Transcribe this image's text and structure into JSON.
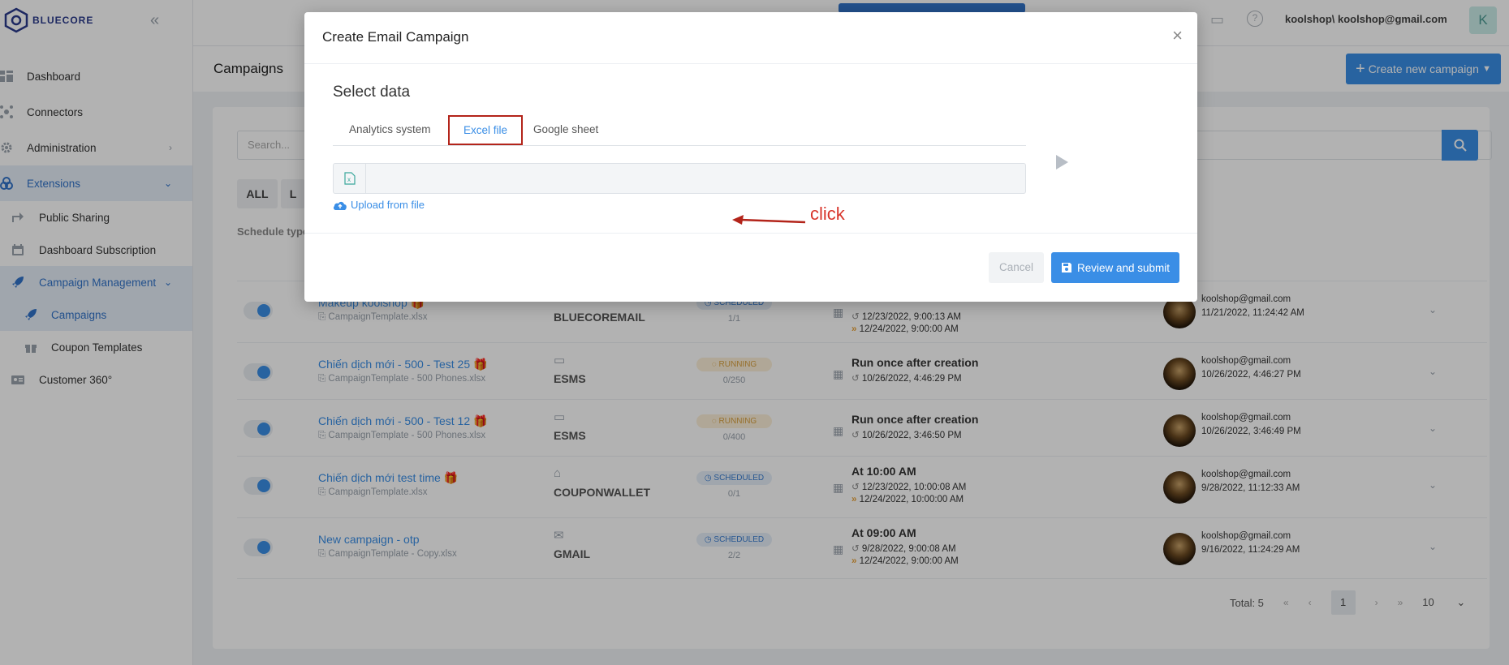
{
  "brand": {
    "name": "BLUECORE"
  },
  "sidebar": {
    "items": [
      {
        "label": "Dashboard",
        "icon": "dashboard-icon"
      },
      {
        "label": "Connectors",
        "icon": "connectors-icon"
      },
      {
        "label": "Administration",
        "icon": "gear-icon"
      },
      {
        "label": "Extensions",
        "icon": "extensions-icon"
      }
    ],
    "sub_items": [
      {
        "label": "Public Sharing",
        "icon": "share-icon"
      },
      {
        "label": "Dashboard Subscription",
        "icon": "calendar-icon"
      },
      {
        "label": "Campaign Management",
        "icon": "rocket-icon"
      },
      {
        "label": "Campaigns",
        "icon": "rocket-icon"
      },
      {
        "label": "Coupon Templates",
        "icon": "gift-icon"
      },
      {
        "label": "Customer 360°",
        "icon": "id-card-icon"
      }
    ]
  },
  "topbar": {
    "user": "koolshop\\ koolshop@gmail.com",
    "avatar_letter": "K"
  },
  "page": {
    "title": "Campaigns",
    "create_button": "Create new campaign"
  },
  "filters": {
    "search_placeholder": "Search...",
    "all": "ALL",
    "l": "L",
    "schedule_type": "Schedule type"
  },
  "campaigns": [
    {
      "name": "Makeup koolshop",
      "file": "CampaignTemplate.xlsx",
      "channel": "BLUECOREMAIL",
      "status": "SCHEDULED",
      "count": "1/1",
      "schedule_title": "",
      "schedule_1": "12/23/2022, 9:00:13 AM",
      "schedule_2": "12/24/2022, 9:00:00 AM",
      "owner": "koolshop@gmail.com",
      "owner_date": "11/21/2022, 11:24:42 AM"
    },
    {
      "name": "Chiến dịch mới - 500 - Test 25",
      "file": "CampaignTemplate - 500 Phones.xlsx",
      "channel": "ESMS",
      "status": "RUNNING",
      "count": "0/250",
      "schedule_title": "Run once after creation",
      "schedule_1": "10/26/2022, 4:46:29 PM",
      "schedule_2": "",
      "owner": "koolshop@gmail.com",
      "owner_date": "10/26/2022, 4:46:27 PM"
    },
    {
      "name": "Chiến dịch mới - 500 - Test 12",
      "file": "CampaignTemplate - 500 Phones.xlsx",
      "channel": "ESMS",
      "status": "RUNNING",
      "count": "0/400",
      "schedule_title": "Run once after creation",
      "schedule_1": "10/26/2022, 3:46:50 PM",
      "schedule_2": "",
      "owner": "koolshop@gmail.com",
      "owner_date": "10/26/2022, 3:46:49 PM"
    },
    {
      "name": "Chiến dịch mới test time",
      "file": "CampaignTemplate.xlsx",
      "channel": "COUPONWALLET",
      "status": "SCHEDULED",
      "count": "0/1",
      "schedule_title": "At 10:00 AM",
      "schedule_1": "12/23/2022, 10:00:08 AM",
      "schedule_2": "12/24/2022, 10:00:00 AM",
      "owner": "koolshop@gmail.com",
      "owner_date": "9/28/2022, 11:12:33 AM"
    },
    {
      "name": "New campaign - otp",
      "file": "CampaignTemplate - Copy.xlsx",
      "channel": "GMAIL",
      "status": "SCHEDULED",
      "count": "2/2",
      "schedule_title": "At 09:00 AM",
      "schedule_1": "9/28/2022, 9:00:08 AM",
      "schedule_2": "12/24/2022, 9:00:00 AM",
      "owner": "koolshop@gmail.com",
      "owner_date": "9/16/2022, 11:24:29 AM"
    }
  ],
  "pager": {
    "total": "Total: 5",
    "first": "«",
    "prev": "‹",
    "current": "1",
    "next": "›",
    "last": "»",
    "size": "10"
  },
  "modal": {
    "title": "Create Email Campaign",
    "section": "Select data",
    "tabs": [
      "Analytics system",
      "Excel file",
      "Google sheet"
    ],
    "active_tab": "Excel file",
    "upload": "Upload from file",
    "annotation": "click",
    "cancel": "Cancel",
    "submit": "Review and submit"
  },
  "colors": {
    "accent": "#3a8ee6",
    "annotation_red": "#d8352b",
    "tab_highlight_border": "#b3241a"
  }
}
